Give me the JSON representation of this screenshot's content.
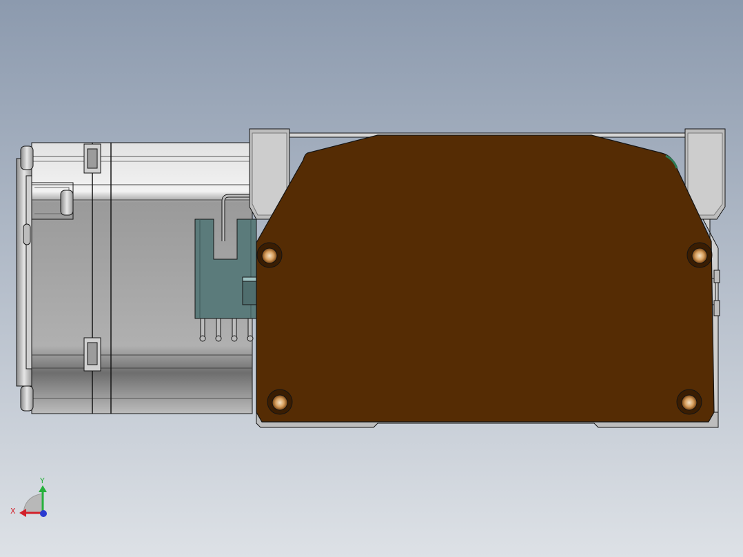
{
  "viewport": {
    "background_top": "#8c9aae",
    "background_bottom": "#dde1e6"
  },
  "model": {
    "pcb_color": "#552c04",
    "connector_color": "#5b7b7b",
    "metal_light": "#e4e4e4",
    "metal_mid": "#bdbdbd",
    "metal_dark": "#8a8a8a",
    "hole_color": "#c98a45",
    "edge_color": "#141414"
  },
  "triad": {
    "x_label": "X",
    "y_label": "Y",
    "x_color": "#d2202a",
    "y_color": "#26b03c",
    "z_color": "#2a3ad0"
  }
}
